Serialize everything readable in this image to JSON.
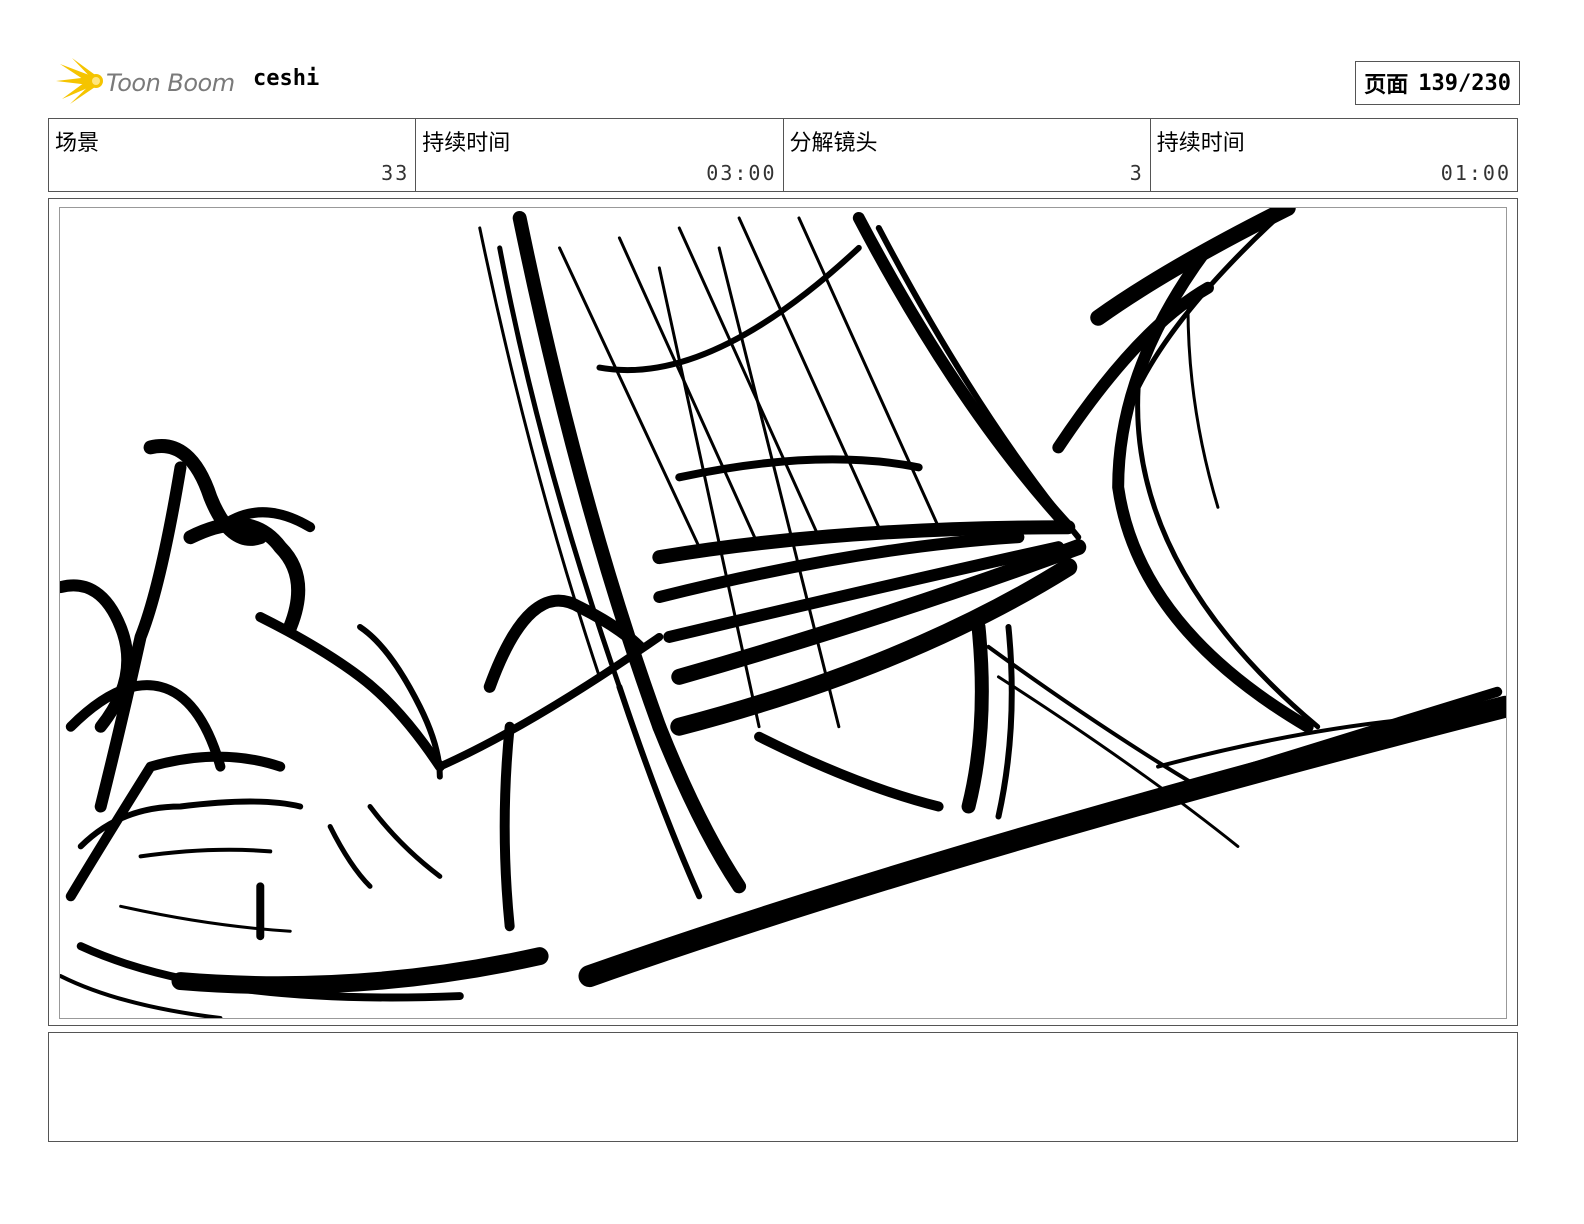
{
  "header": {
    "logo_text": "Toon Boom",
    "project_name": "ceshi",
    "page_label": "页面",
    "page_value": "139/230"
  },
  "info": {
    "scene_label": "场景",
    "scene_value": "33",
    "scene_duration_label": "持续时间",
    "scene_duration_value": "03:00",
    "panel_label": "分解镜头",
    "panel_value": "3",
    "panel_duration_label": "持续时间",
    "panel_duration_value": "01:00"
  },
  "colors": {
    "logo_yellow": "#f5c400",
    "logo_text": "#7a7a7a",
    "ink": "#000000"
  },
  "notes": {
    "text": ""
  }
}
